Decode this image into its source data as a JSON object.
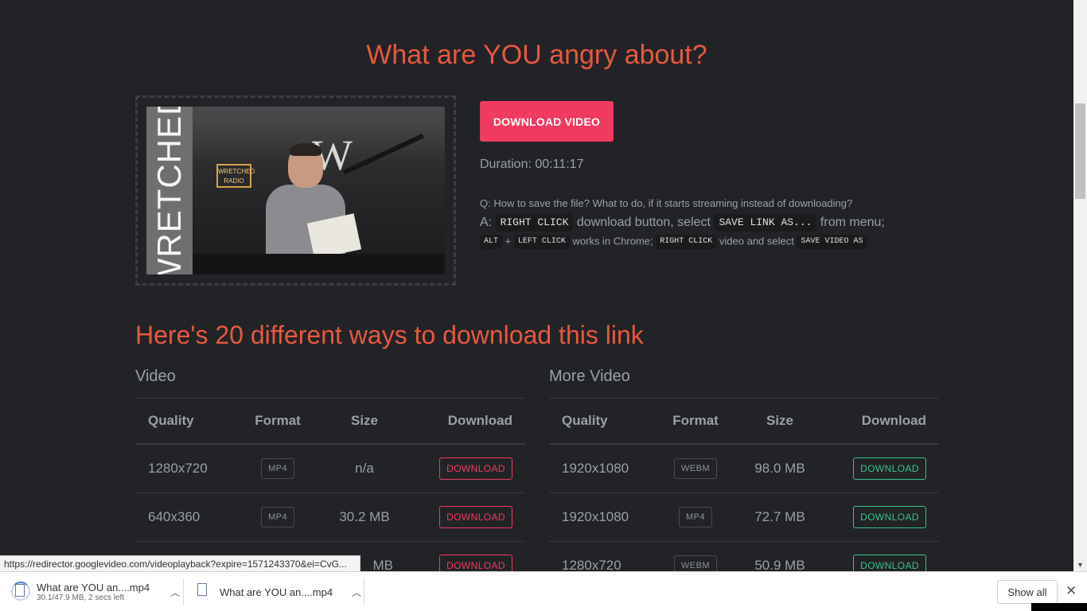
{
  "page": {
    "title": "What are YOU angry about?",
    "download_video_button": "DOWNLOAD VIDEO",
    "duration": "Duration: 00:11:17",
    "faq_question": "Q: How to save the file? What to do, if it starts streaming instead of downloading?",
    "faq_answer": {
      "prefix": "A:",
      "kbd_right_click": "RIGHT CLICK",
      "text_1": "download button, select",
      "kbd_save_link": "SAVE LINK AS...",
      "text_2": "from menu;",
      "kbd_alt": "ALT",
      "plus": "+",
      "kbd_left_click": "LEFT CLICK",
      "text_3": "works in Chrome;",
      "kbd_right_click_2": "RIGHT CLICK",
      "text_4": "video and select",
      "kbd_save_video": "SAVE VIDEO AS"
    },
    "thumbnail": {
      "banner_text": "WRETCHED",
      "sign_text_1": "WRETCHED",
      "sign_text_2": "RADIO",
      "logo_letter": "W"
    },
    "section_title": "Here's 20 different ways to download this link"
  },
  "tables": {
    "video": {
      "caption": "Video",
      "headers": {
        "quality": "Quality",
        "format": "Format",
        "size": "Size",
        "download": "Download"
      },
      "rows": [
        {
          "quality": "1280x720",
          "format": "MP4",
          "size": "n/a",
          "download": "DOWNLOAD"
        },
        {
          "quality": "640x360",
          "format": "MP4",
          "size": "30.2 MB",
          "download": "DOWNLOAD"
        },
        {
          "quality": "",
          "format": "",
          "size": "MB",
          "download": "DOWNLOAD"
        }
      ]
    },
    "more_video": {
      "caption": "More Video",
      "headers": {
        "quality": "Quality",
        "format": "Format",
        "size": "Size",
        "download": "Download"
      },
      "rows": [
        {
          "quality": "1920x1080",
          "format": "WEBM",
          "size": "98.0 MB",
          "download": "DOWNLOAD"
        },
        {
          "quality": "1920x1080",
          "format": "MP4",
          "size": "72.7 MB",
          "download": "DOWNLOAD"
        },
        {
          "quality": "1280x720",
          "format": "WEBM",
          "size": "50.9 MB",
          "download": "DOWNLOAD"
        }
      ]
    }
  },
  "status_bar": {
    "url": "https://redirector.googlevideo.com/videoplayback?expire=1571243370&ei=CvG..."
  },
  "download_shelf": {
    "items": [
      {
        "name": "What are YOU an....mp4",
        "status": "30.1/47.9 MB, 2 secs left",
        "progress": 0.63
      },
      {
        "name": "What are YOU an....mp4",
        "status": ""
      }
    ],
    "show_all": "Show all",
    "close": "✕"
  },
  "colors": {
    "background": "#222326",
    "title_accent": "#e8583e",
    "primary_button": "#f03a5f",
    "download_red": "#f03a5f",
    "download_green": "#36c487"
  }
}
